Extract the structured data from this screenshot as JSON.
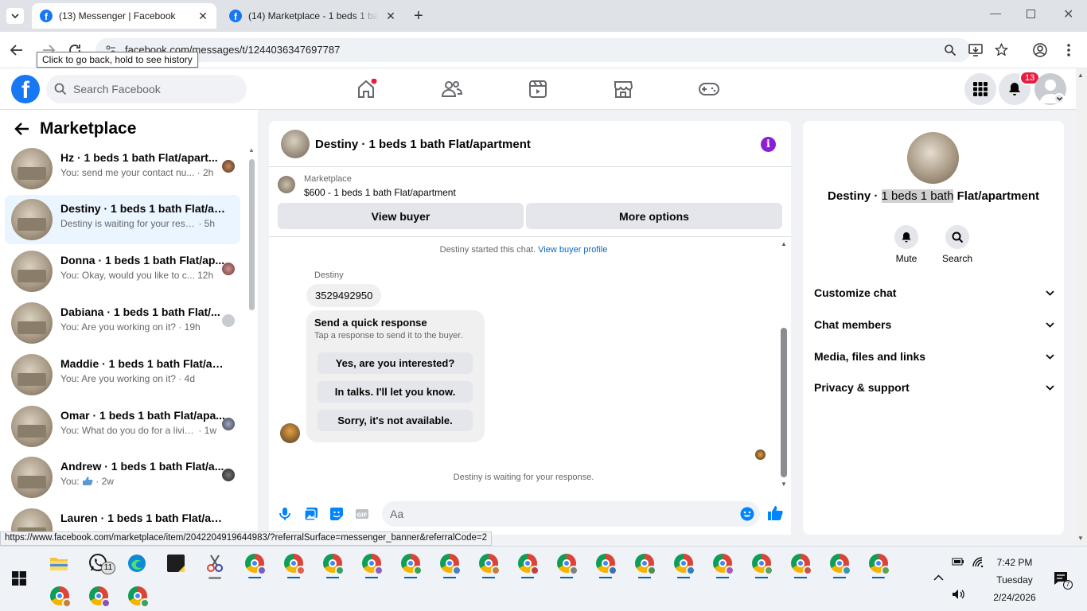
{
  "browser": {
    "tabs": [
      {
        "title": "(13) Messenger | Facebook",
        "active": true
      },
      {
        "title": "(14) Marketplace - 1 beds 1 bath",
        "active": false
      }
    ],
    "url": "facebook.com/messages/t/1244036347697787",
    "back_tooltip": "Click to go back, hold to see history",
    "status_url": "https://www.facebook.com/marketplace/item/2042204919644983/?referralSurface=messenger_banner&referralCode=2"
  },
  "fb_header": {
    "search_placeholder": "Search Facebook",
    "notification_count": "13",
    "brand_color": "#1877f2"
  },
  "sidebar": {
    "title": "Marketplace",
    "conversations": [
      {
        "name": "Hz · 1 beds 1 bath Flat/apart...",
        "preview": "You: send me your contact nu...",
        "time": "· 2h",
        "selected": false
      },
      {
        "name": "Destiny · 1 beds 1 bath Flat/apa...",
        "preview": "Destiny is waiting for your respon...",
        "time": "· 5h",
        "selected": true
      },
      {
        "name": "Donna · 1 beds 1 bath Flat/ap...",
        "preview": "You: Okay, would you like to c...",
        "time": "12h",
        "selected": false
      },
      {
        "name": "Dabiana · 1 beds 1 bath Flat/...",
        "preview": "You: Are you working on it?",
        "time": "· 19h",
        "selected": false
      },
      {
        "name": "Maddie · 1 beds 1 bath Flat/apa...",
        "preview": "You: Are you working on it?",
        "time": "· 4d",
        "selected": false
      },
      {
        "name": "Omar · 1 beds 1 bath Flat/apa...",
        "preview": "You: What do you do for a livin...",
        "time": "· 1w",
        "selected": false
      },
      {
        "name": "Andrew · 1 beds 1 bath Flat/a...",
        "preview": "You:",
        "time": "· 2w",
        "selected": false
      },
      {
        "name": "Lauren · 1 beds 1 bath Flat/apar...",
        "preview": "",
        "time": "",
        "selected": false
      }
    ]
  },
  "chat": {
    "title": "Destiny · 1 beds 1 bath Flat/apartment",
    "listing_label": "Marketplace",
    "listing_price": "$600 - 1 beds 1 bath Flat/apartment",
    "view_buyer": "View buyer",
    "more_options": "More options",
    "system_message": "Destiny started this chat.",
    "view_buyer_profile": "View buyer profile",
    "sender_name": "Destiny",
    "message_text": "3529492950",
    "quick_response_title": "Send a quick response",
    "quick_response_subtitle": "Tap a response to send it to the buyer.",
    "quick_responses": [
      "Yes, are you interested?",
      "In talks. I'll let you know.",
      "Sorry, it's not available."
    ],
    "waiting_text": "Destiny is waiting for your response.",
    "input_placeholder": "Aa",
    "accent_color": "#0084ff"
  },
  "right_panel": {
    "title_prefix": "Destiny · ",
    "title_highlight": "1 beds 1 bath",
    "title_suffix": " Flat/apartment",
    "mute_label": "Mute",
    "search_label": "Search",
    "sections": [
      "Customize chat",
      "Chat members",
      "Media, files and links",
      "Privacy & support"
    ]
  },
  "taskbar": {
    "time": "7:42 PM",
    "day": "Tuesday",
    "date": "2/24/2026",
    "whatsapp_badge": "11",
    "notif_badge": "7"
  }
}
